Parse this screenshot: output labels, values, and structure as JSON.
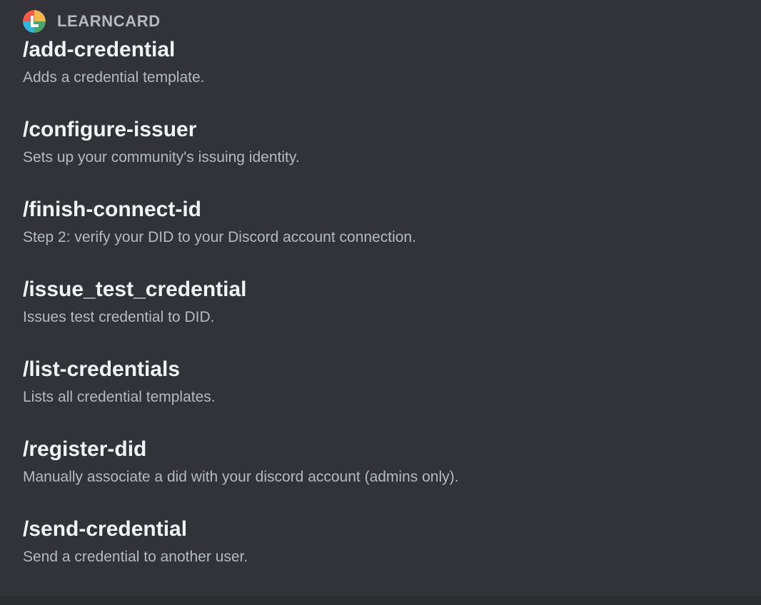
{
  "app": {
    "name": "LEARNCARD"
  },
  "commands": [
    {
      "name": "/add-credential",
      "description": "Adds a credential template."
    },
    {
      "name": "/configure-issuer",
      "description": "Sets up your community's issuing identity."
    },
    {
      "name": "/finish-connect-id",
      "description": "Step 2: verify your DID to your Discord account connection."
    },
    {
      "name": "/issue_test_credential",
      "description": "Issues test credential to DID."
    },
    {
      "name": "/list-credentials",
      "description": "Lists all credential templates."
    },
    {
      "name": "/register-did",
      "description": "Manually associate a did with your discord account (admins only)."
    },
    {
      "name": "/send-credential",
      "description": "Send a credential to another user."
    }
  ],
  "colors": {
    "background": "#313338",
    "title_text": "#f2f3f5",
    "muted_text": "#b5bac1"
  },
  "icons": {
    "app_icon": "learncard-logo-icon"
  }
}
